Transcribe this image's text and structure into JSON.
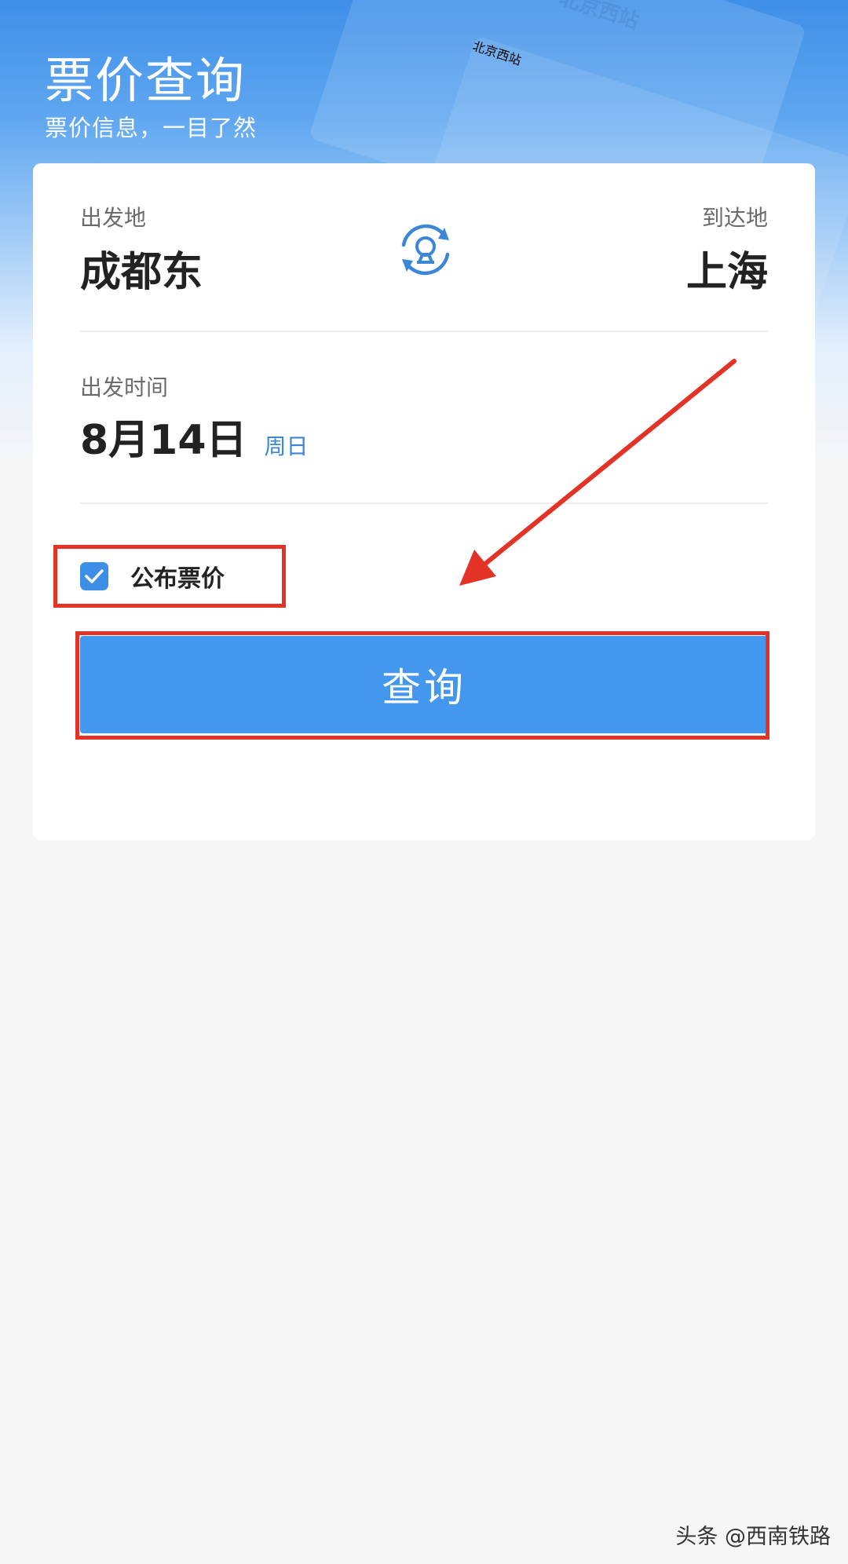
{
  "header": {
    "title": "票价查询",
    "subtitle": "票价信息，一目了然",
    "decoration_text": [
      "北京西站",
      "北京西站"
    ]
  },
  "route": {
    "from_label": "出发地",
    "from_station": "成都东",
    "to_label": "到达地",
    "to_station": "上海",
    "swap_icon": "railway-swap-icon"
  },
  "date": {
    "label": "出发时间",
    "value": "8月14日",
    "weekday": "周日"
  },
  "options": {
    "published_fare_label": "公布票价",
    "published_fare_checked": true
  },
  "actions": {
    "query_label": "查询"
  },
  "watermark": "头条 @西南铁路",
  "colors": {
    "primary": "#4398ee",
    "annotation": "#e33226",
    "accent_text": "#3a86d8"
  }
}
